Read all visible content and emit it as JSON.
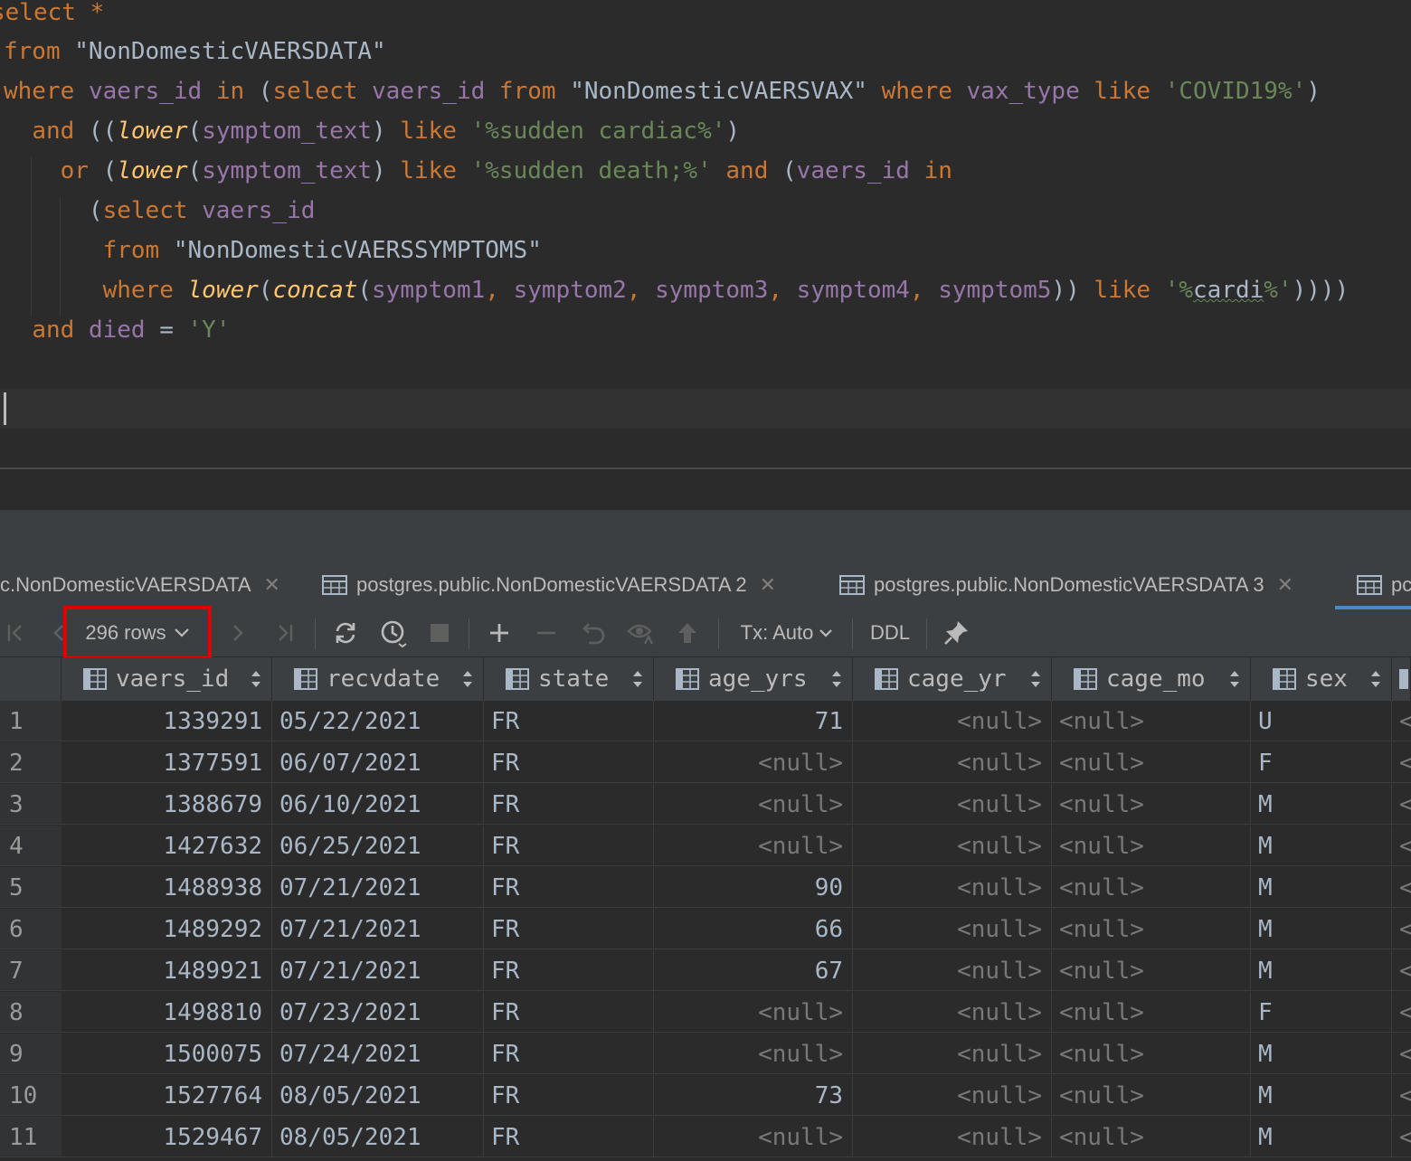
{
  "editor": {
    "lines": [
      [
        [
          "kw",
          "select"
        ],
        [
          "plain",
          " "
        ],
        [
          "kw",
          "*"
        ]
      ],
      [
        [
          "kw",
          "from"
        ],
        [
          "plain",
          " \"NonDomesticVAERSDATA\""
        ]
      ],
      [
        [
          "kw",
          "where"
        ],
        [
          "plain",
          " "
        ],
        [
          "ident",
          "vaers_id"
        ],
        [
          "plain",
          " "
        ],
        [
          "kw",
          "in"
        ],
        [
          "plain",
          " ("
        ],
        [
          "kw",
          "select"
        ],
        [
          "plain",
          " "
        ],
        [
          "ident",
          "vaers_id"
        ],
        [
          "plain",
          " "
        ],
        [
          "kw",
          "from"
        ],
        [
          "plain",
          " \"NonDomesticVAERSVAX\" "
        ],
        [
          "kw",
          "where"
        ],
        [
          "plain",
          " "
        ],
        [
          "ident",
          "vax_type"
        ],
        [
          "plain",
          " "
        ],
        [
          "kw",
          "like"
        ],
        [
          "plain",
          " "
        ],
        [
          "str",
          "'COVID19%'"
        ],
        [
          "plain",
          ")"
        ]
      ],
      [
        [
          "plain",
          "  "
        ],
        [
          "kw",
          "and"
        ],
        [
          "plain",
          " (("
        ],
        [
          "fn",
          "lower"
        ],
        [
          "plain",
          "("
        ],
        [
          "ident",
          "symptom_text"
        ],
        [
          "plain",
          ") "
        ],
        [
          "kw",
          "like"
        ],
        [
          "plain",
          " "
        ],
        [
          "str",
          "'%sudden cardiac%'"
        ],
        [
          "plain",
          ")"
        ]
      ],
      [
        [
          "plain",
          "    "
        ],
        [
          "kw",
          "or"
        ],
        [
          "plain",
          " ("
        ],
        [
          "fn",
          "lower"
        ],
        [
          "plain",
          "("
        ],
        [
          "ident",
          "symptom_text"
        ],
        [
          "plain",
          ") "
        ],
        [
          "kw",
          "like"
        ],
        [
          "plain",
          " "
        ],
        [
          "str",
          "'%sudden death;%'"
        ],
        [
          "plain",
          " "
        ],
        [
          "kw",
          "and"
        ],
        [
          "plain",
          " ("
        ],
        [
          "ident",
          "vaers_id"
        ],
        [
          "plain",
          " "
        ],
        [
          "kw",
          "in"
        ]
      ],
      [
        [
          "plain",
          "      ("
        ],
        [
          "kw",
          "select"
        ],
        [
          "plain",
          " "
        ],
        [
          "ident",
          "vaers_id"
        ]
      ],
      [
        [
          "plain",
          "       "
        ],
        [
          "kw",
          "from"
        ],
        [
          "plain",
          " \"NonDomesticVAERSSYMPTOMS\""
        ]
      ],
      [
        [
          "plain",
          "       "
        ],
        [
          "kw",
          "where"
        ],
        [
          "plain",
          " "
        ],
        [
          "fn",
          "lower"
        ],
        [
          "plain",
          "("
        ],
        [
          "fn",
          "concat"
        ],
        [
          "plain",
          "("
        ],
        [
          "ident",
          "symptom1"
        ],
        [
          "kw",
          ","
        ],
        [
          "plain",
          " "
        ],
        [
          "ident",
          "symptom2"
        ],
        [
          "kw",
          ","
        ],
        [
          "plain",
          " "
        ],
        [
          "ident",
          "symptom3"
        ],
        [
          "kw",
          ","
        ],
        [
          "plain",
          " "
        ],
        [
          "ident",
          "symptom4"
        ],
        [
          "kw",
          ","
        ],
        [
          "plain",
          " "
        ],
        [
          "ident",
          "symptom5"
        ],
        [
          "plain",
          "))"
        ],
        [
          "plain",
          " "
        ],
        [
          "kw",
          "like"
        ],
        [
          "plain",
          " "
        ],
        [
          "str",
          "'%"
        ],
        [
          "squig",
          "cardi"
        ],
        [
          "str",
          "%'"
        ],
        [
          "plain",
          "))))"
        ]
      ],
      [
        [
          "plain",
          "  "
        ],
        [
          "kw",
          "and"
        ],
        [
          "plain",
          " "
        ],
        [
          "ident",
          "died"
        ],
        [
          "plain",
          " = "
        ],
        [
          "str",
          "'Y'"
        ]
      ]
    ]
  },
  "tabs": [
    {
      "label": "c.NonDomesticVAERSDATA",
      "close": "✕",
      "icon": false
    },
    {
      "label": "postgres.public.NonDomesticVAERSDATA 2",
      "close": "✕",
      "icon": true
    },
    {
      "label": "postgres.public.NonDomesticVAERSDATA 3",
      "close": "✕",
      "icon": true
    },
    {
      "label": "pc",
      "close": "",
      "icon": true
    }
  ],
  "toolbar": {
    "rows_label": "296 rows",
    "tx_label": "Tx: Auto",
    "ddl_label": "DDL"
  },
  "grid": {
    "columns": [
      "vaers_id",
      "recvdate",
      "state",
      "age_yrs",
      "cage_yr",
      "cage_mo",
      "sex"
    ],
    "rows": [
      [
        "1",
        "1339291",
        "05/22/2021",
        "FR",
        "71",
        "<null>",
        "<null>",
        "U"
      ],
      [
        "2",
        "1377591",
        "06/07/2021",
        "FR",
        "<null>",
        "<null>",
        "<null>",
        "F"
      ],
      [
        "3",
        "1388679",
        "06/10/2021",
        "FR",
        "<null>",
        "<null>",
        "<null>",
        "M"
      ],
      [
        "4",
        "1427632",
        "06/25/2021",
        "FR",
        "<null>",
        "<null>",
        "<null>",
        "M"
      ],
      [
        "5",
        "1488938",
        "07/21/2021",
        "FR",
        "90",
        "<null>",
        "<null>",
        "M"
      ],
      [
        "6",
        "1489292",
        "07/21/2021",
        "FR",
        "66",
        "<null>",
        "<null>",
        "M"
      ],
      [
        "7",
        "1489921",
        "07/21/2021",
        "FR",
        "67",
        "<null>",
        "<null>",
        "M"
      ],
      [
        "8",
        "1498810",
        "07/23/2021",
        "FR",
        "<null>",
        "<null>",
        "<null>",
        "F"
      ],
      [
        "9",
        "1500075",
        "07/24/2021",
        "FR",
        "<null>",
        "<null>",
        "<null>",
        "M"
      ],
      [
        "10",
        "1527764",
        "08/05/2021",
        "FR",
        "73",
        "<null>",
        "<null>",
        "M"
      ],
      [
        "11",
        "1529467",
        "08/05/2021",
        "FR",
        "<null>",
        "<null>",
        "<null>",
        "M"
      ]
    ],
    "overflow_glyph": "<"
  },
  "colors": {
    "accent": "#4a88c7",
    "highlight_box": "#e50000",
    "keyword": "#cc7832",
    "string": "#6a8759",
    "identifier": "#9876aa",
    "function": "#ffc66d"
  }
}
